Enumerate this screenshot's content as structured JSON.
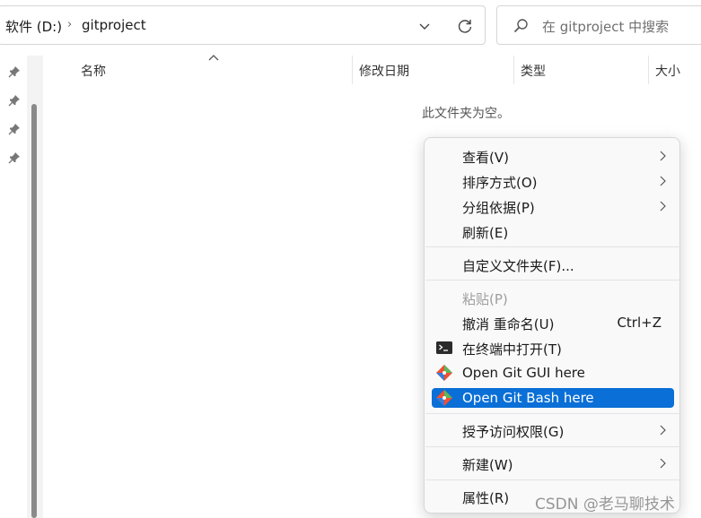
{
  "address_bar": {
    "drive": "软件 (D:)",
    "separator": "›",
    "folder": "gitproject"
  },
  "search": {
    "placeholder": "在 gitproject 中搜索"
  },
  "columns": [
    "名称",
    "修改日期",
    "类型",
    "大小"
  ],
  "empty_message": "此文件夹为空。",
  "context_menu": {
    "view": {
      "label": "查看(V)"
    },
    "sort": {
      "label": "排序方式(O)"
    },
    "group": {
      "label": "分组依据(P)"
    },
    "refresh": {
      "label": "刷新(E)"
    },
    "customize": {
      "label": "自定义文件夹(F)..."
    },
    "paste": {
      "label": "粘贴(P)"
    },
    "undo": {
      "label": "撤消 重命名(U)",
      "shortcut": "Ctrl+Z"
    },
    "terminal": {
      "label": "在终端中打开(T)"
    },
    "git_gui": {
      "label": "Open Git GUI here"
    },
    "git_bash": {
      "label": "Open Git Bash here"
    },
    "access": {
      "label": "授予访问权限(G)"
    },
    "new": {
      "label": "新建(W)"
    },
    "properties": {
      "label": "属性(R)"
    }
  },
  "watermark": "CSDN @老马聊技术",
  "colors": {
    "selection": "#0a6fd6",
    "git_red": "#f05033"
  }
}
